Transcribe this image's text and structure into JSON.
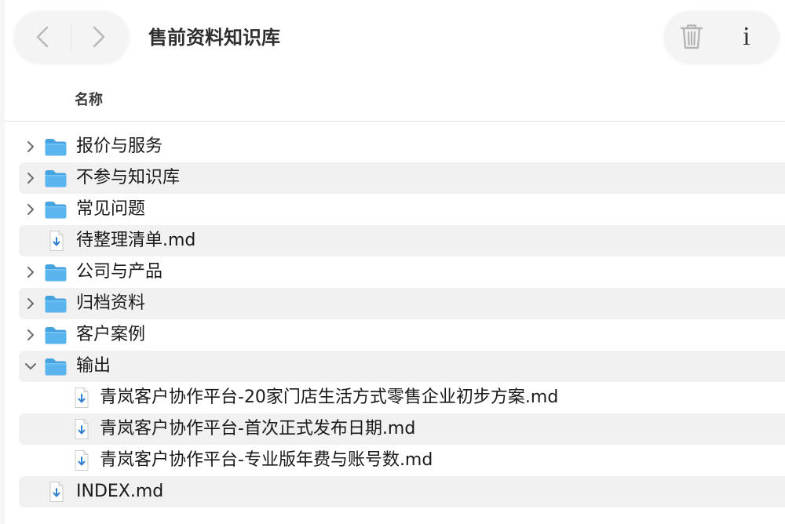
{
  "window": {
    "title": "售前资料知识库"
  },
  "toolbar": {
    "back_icon": "chevron-left-icon",
    "forward_icon": "chevron-right-icon",
    "delete_icon": "trash-icon",
    "info_icon": "info-icon",
    "info_glyph": "i"
  },
  "columns": {
    "name_header": "名称"
  },
  "colors": {
    "folder": "#5ab4ee",
    "folder_tab": "#46a3e1",
    "file_arrow": "#2f7fd0",
    "row_alt": "#f1f1f1"
  },
  "files": [
    {
      "name": "报价与服务",
      "type": "folder",
      "expanded": false,
      "depth": 0
    },
    {
      "name": "不参与知识库",
      "type": "folder",
      "expanded": false,
      "depth": 0
    },
    {
      "name": "常见问题",
      "type": "folder",
      "expanded": false,
      "depth": 0
    },
    {
      "name": "待整理清单.md",
      "type": "md-file",
      "depth": 0
    },
    {
      "name": "公司与产品",
      "type": "folder",
      "expanded": false,
      "depth": 0
    },
    {
      "name": "归档资料",
      "type": "folder",
      "expanded": false,
      "depth": 0
    },
    {
      "name": "客户案例",
      "type": "folder",
      "expanded": false,
      "depth": 0
    },
    {
      "name": "输出",
      "type": "folder",
      "expanded": true,
      "depth": 0
    },
    {
      "name": "青岚客户协作平台-20家门店生活方式零售企业初步方案.md",
      "type": "md-file",
      "depth": 1
    },
    {
      "name": "青岚客户协作平台-首次正式发布日期.md",
      "type": "md-file",
      "depth": 1
    },
    {
      "name": "青岚客户协作平台-专业版年费与账号数.md",
      "type": "md-file",
      "depth": 1
    },
    {
      "name": "INDEX.md",
      "type": "md-file",
      "depth": 0
    }
  ]
}
